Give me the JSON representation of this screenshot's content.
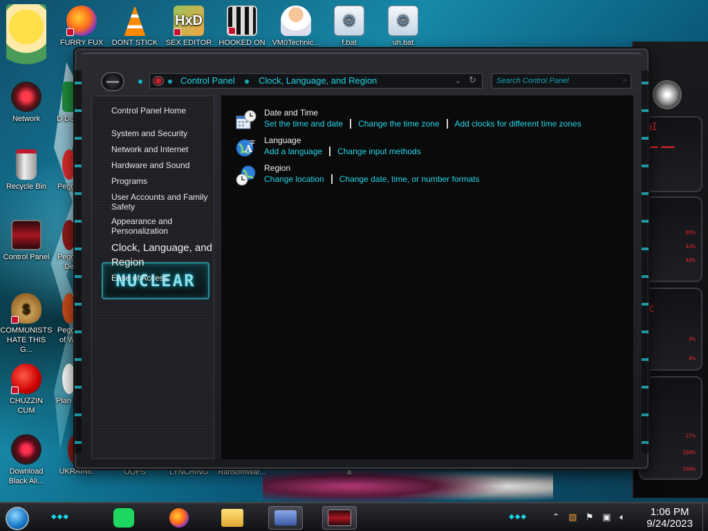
{
  "desktop": {
    "top_icons": [
      {
        "label": "",
        "icon": "cartoon-girl-icon"
      },
      {
        "label": "FURRY FUX",
        "icon": "firefox-icon"
      },
      {
        "label": "DONT STICK",
        "icon": "vlc-cone-icon"
      },
      {
        "label": "SEX EDITOR",
        "icon": "hxd-editor-icon"
      },
      {
        "label": "HOOKED ON",
        "icon": "maze-app-icon"
      },
      {
        "label": "VM0Technic...",
        "icon": "doctor-icon"
      },
      {
        "label": "f.bat",
        "icon": "batch-file-icon"
      },
      {
        "label": "uh.bat",
        "icon": "batch-file-icon"
      }
    ],
    "left_icons": [
      {
        "label": "Network",
        "icon": "network-orb-icon"
      },
      {
        "label": "Recycle Bin",
        "icon": "recycle-bin-icon"
      },
      {
        "label": "Control Panel",
        "icon": "control-panel-icon"
      },
      {
        "label": "COMMUNISTS HATE THIS G...",
        "icon": "money-bag-icon"
      },
      {
        "label": "CHUZZIN CUM",
        "icon": "chuzzle-icon"
      },
      {
        "label": "Download Black Ali...",
        "icon": "alien-orb-icon"
      }
    ],
    "second_col_icons": [
      {
        "label": "D DUM",
        "icon": "app-icon"
      },
      {
        "label": "Peggle",
        "icon": "peggle-icon"
      },
      {
        "label": "Peggle De",
        "icon": "peggle-icon"
      },
      {
        "label": "Peggle of Wa",
        "icon": "peggle-icon"
      },
      {
        "label": "Plan Zo",
        "icon": "plants-zombies-icon"
      },
      {
        "label": "UKRAINE",
        "icon": "app-icon"
      }
    ],
    "bottom_labels": [
      "OOPS",
      "LYNCHING",
      "RansomWar...",
      "a"
    ]
  },
  "window": {
    "breadcrumb": [
      "Control Panel",
      "Clock, Language, and Region"
    ],
    "search_placeholder": "Search Control Panel",
    "nav": {
      "home": "Control Panel Home",
      "items": [
        "System and Security",
        "Network and Internet",
        "Hardware and Sound",
        "Programs",
        "User Accounts and Family Safety",
        "Appearance and Personalization",
        "Clock, Language, and Region",
        "Ease of Access"
      ],
      "current": "Clock, Language, and Region"
    },
    "logo_text": "NUCLEAR",
    "categories": [
      {
        "title": "Date and Time",
        "icon": "calendar-clock-icon",
        "links": [
          "Set the time and date",
          "Change the time zone",
          "Add clocks for different time zones"
        ]
      },
      {
        "title": "Language",
        "icon": "globe-language-icon",
        "links": [
          "Add a language",
          "Change input methods"
        ]
      },
      {
        "title": "Region",
        "icon": "globe-clock-icon",
        "links": [
          "Change location",
          "Change date, time, or number formats"
        ]
      }
    ]
  },
  "taskbar": {
    "pinned": [
      {
        "name": "spotify",
        "icon": "spotify-icon"
      },
      {
        "name": "firefox",
        "icon": "firefox-icon"
      },
      {
        "name": "explorer",
        "icon": "folder-icon"
      },
      {
        "name": "id-card",
        "icon": "id-card-icon"
      },
      {
        "name": "control-panel",
        "icon": "control-panel-icon"
      }
    ],
    "tray_icons": [
      "up-arrow-icon",
      "jar-icon",
      "flag-icon",
      "network-icon",
      "volume-icon"
    ],
    "time": "1:06 PM",
    "date": "9/24/2023"
  },
  "colors": {
    "accent_cyan": "#24d7ea",
    "window_bg": "#0a0a0b",
    "frame": "#2a2b30",
    "alert_red": "#e3262b"
  }
}
